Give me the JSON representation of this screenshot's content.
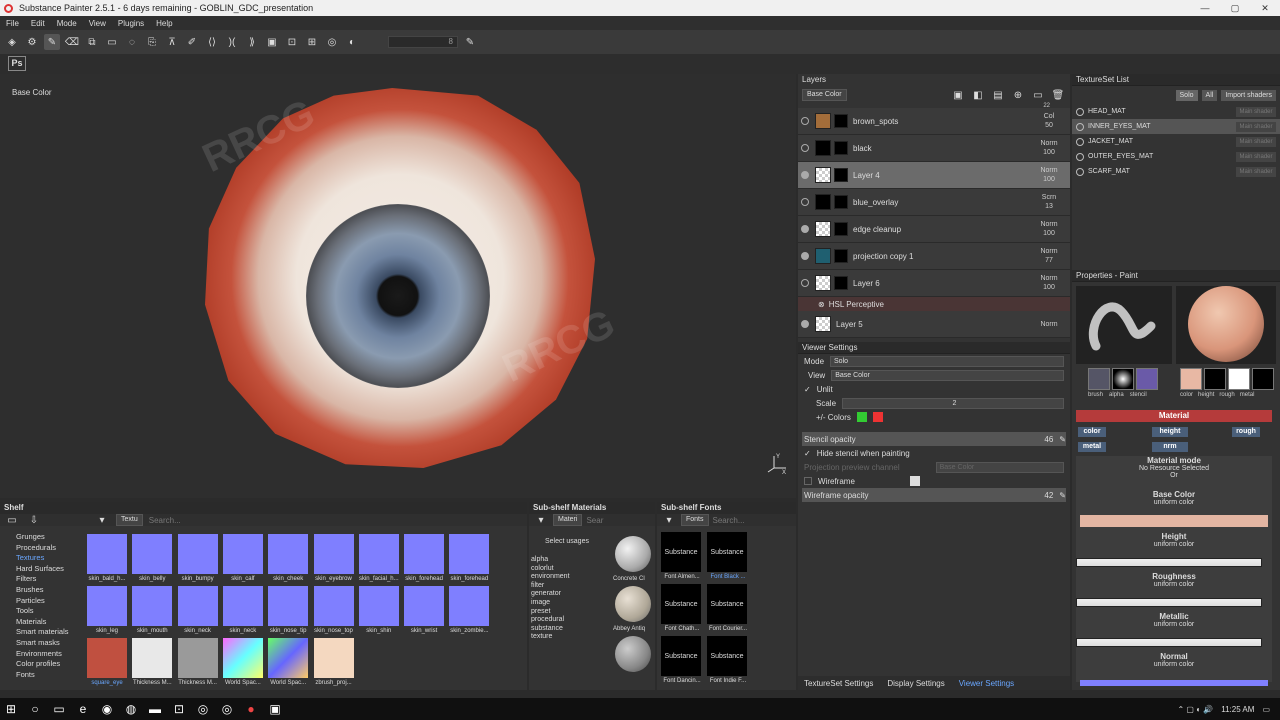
{
  "window": {
    "title": "Substance Painter 2.5.1 - 6 days remaining - GOBLIN_GDC_presentation",
    "min": "—",
    "max": "▢",
    "close": "✕"
  },
  "menu": [
    "File",
    "Edit",
    "Mode",
    "View",
    "Plugins",
    "Help"
  ],
  "toolbar": {
    "size_value": "8"
  },
  "ps_button": "Ps",
  "viewport": {
    "channel_label": "Base Color",
    "axis_y": "Y",
    "axis_x": "X"
  },
  "layers": {
    "title": "Layers",
    "channel_dropdown": "Base Color",
    "scroll_value": "22",
    "rows": [
      {
        "name": "brown_spots",
        "blend": "Col",
        "opacity": "50",
        "thumb": "brn",
        "visible": false,
        "selected": false
      },
      {
        "name": "black",
        "blend": "Norm",
        "opacity": "100",
        "thumb": "blk",
        "visible": false,
        "selected": false
      },
      {
        "name": "Layer 4",
        "blend": "Norm",
        "opacity": "100",
        "thumb": "chk",
        "visible": true,
        "selected": true
      },
      {
        "name": "blue_overlay",
        "blend": "Scrn",
        "opacity": "13",
        "thumb": "blk",
        "visible": false,
        "selected": false
      },
      {
        "name": "edge cleanup",
        "blend": "Norm",
        "opacity": "100",
        "thumb": "chk",
        "visible": true,
        "selected": false
      },
      {
        "name": "projection copy 1",
        "blend": "Norm",
        "opacity": "77",
        "thumb": "blu",
        "visible": true,
        "selected": false
      },
      {
        "name": "Layer 6",
        "blend": "Norm",
        "opacity": "100",
        "thumb": "chk",
        "visible": false,
        "selected": false
      }
    ],
    "hsl": "HSL Perceptive",
    "last_row": {
      "name": "Layer 5",
      "blend": "Norm"
    }
  },
  "textureset": {
    "title": "TextureSet List",
    "solo": "Solo",
    "all": "All",
    "import": "Import shaders",
    "items": [
      "HEAD_MAT",
      "INNER_EYES_MAT",
      "JACKET_MAT",
      "OUTER_EYES_MAT",
      "SCARF_MAT"
    ],
    "shader": "Main shader"
  },
  "viewer": {
    "title": "Viewer Settings",
    "mode_label": "Mode",
    "mode": "Solo",
    "view_label": "View",
    "view": "Base Color",
    "unlit": "Unlit",
    "scale": "Scale",
    "scale_value": "2",
    "colors": "+/- Colors",
    "stencil": "Stencil opacity",
    "stencil_value": "46",
    "hide_stencil": "Hide stencil when painting",
    "proj_channel": "Projection preview channel",
    "proj_value": "Base Color",
    "wireframe": "Wireframe",
    "wire_opacity": "Wireframe opacity",
    "wire_value": "42"
  },
  "bottom_tabs": [
    "TextureSet Settings",
    "Display Settings",
    "Viewer Settings"
  ],
  "props": {
    "title": "Properties - Paint",
    "brush_labels": [
      "brush",
      "alpha",
      "stencil"
    ],
    "mat_labels": [
      "color",
      "height",
      "rough",
      "metal"
    ],
    "material": "Material",
    "pills": [
      "color",
      "height",
      "rough",
      "metal",
      "nrm"
    ],
    "mode_title": "Material mode",
    "mode_value": "No Resource Selected",
    "or": "Or",
    "base_color": "Base Color",
    "uniform": "uniform color",
    "height": "Height",
    "roughness": "Roughness",
    "metallic": "Metallic",
    "normal": "Normal"
  },
  "shelf": {
    "title": "Shelf",
    "filter": "Textu",
    "search": "Search...",
    "categories": [
      "Grunges",
      "Procedurals",
      "Textures",
      "Hard Surfaces",
      "Filters",
      "Brushes",
      "Particles",
      "Tools",
      "Materials",
      "Smart materials",
      "Smart masks",
      "Environments",
      "Color profiles",
      "Fonts"
    ],
    "row1": [
      "skin_bald_h...",
      "skin_belly",
      "skin_bumpy",
      "skin_calf",
      "skin_cheek",
      "skin_eyebrow",
      "skin_facial_h...",
      "skin_forehead",
      "skin_forehead"
    ],
    "row2": [
      "skin_leg",
      "skin_mouth",
      "skin_neck",
      "skin_neck",
      "skin_nose_tip",
      "skin_nose_top",
      "skin_shin",
      "skin_wrist",
      "skin_zombie..."
    ],
    "row3": [
      "square_eye",
      "Thickness M...",
      "Thickness M...",
      "World Spac...",
      "World Spac...",
      "zbrush_proj..."
    ]
  },
  "submat": {
    "title": "Sub-shelf Materials",
    "filter": "Materi",
    "search": "Sear",
    "usage_title": "Select usages",
    "usages": [
      "alpha",
      "colorlut",
      "environment",
      "filter",
      "generator",
      "image",
      "preset",
      "procedural",
      "substance",
      "texture"
    ],
    "items": [
      "Concrete Cl",
      "Abbey Antiq"
    ]
  },
  "subfont": {
    "title": "Sub-shelf Fonts",
    "filter": "Fonts",
    "search": "Search...",
    "items": [
      {
        "label": "Font Almen...",
        "text": "Substance"
      },
      {
        "label": "Font Black ...",
        "text": "Substance"
      },
      {
        "label": "Font Chath...",
        "text": "Substance"
      },
      {
        "label": "Font Courier...",
        "text": "Substance"
      },
      {
        "label": "Font Dancin...",
        "text": "Substance"
      },
      {
        "label": "Font Indie F...",
        "text": "Substance"
      }
    ]
  },
  "taskbar": {
    "time": "11:25 AM"
  },
  "colors": {
    "accent": "#b53b3b",
    "link": "#6aa7ff",
    "tile": "#7f7fff"
  }
}
